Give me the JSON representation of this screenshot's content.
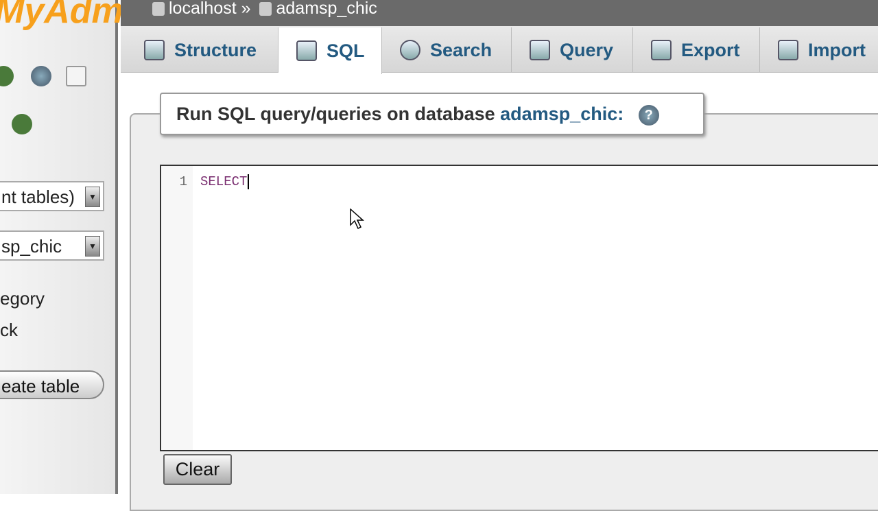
{
  "sidebar": {
    "logo": "MyAdmin",
    "table_filter_select": "nt tables)",
    "database_select": "sp_chic",
    "tables": [
      "egory",
      "ck"
    ],
    "create_table_label": "eate table"
  },
  "breadcrumb": {
    "server": "localhost",
    "separator": "»",
    "database": "adamsp_chic"
  },
  "tabs": [
    {
      "label": "Structure",
      "icon": "structure-icon"
    },
    {
      "label": "SQL",
      "icon": "sql-icon",
      "active": true
    },
    {
      "label": "Search",
      "icon": "search-icon"
    },
    {
      "label": "Query",
      "icon": "query-icon"
    },
    {
      "label": "Export",
      "icon": "export-icon"
    },
    {
      "label": "Import",
      "icon": "import-icon"
    }
  ],
  "sql": {
    "legend_prefix": "Run SQL query/queries on database",
    "database": "adamsp_chic:",
    "line_number": "1",
    "query": "SELECT",
    "clear_label": "Clear"
  },
  "colors": {
    "accent": "#235a81",
    "logo": "#f7a01c",
    "keyword": "#7a2e70"
  }
}
